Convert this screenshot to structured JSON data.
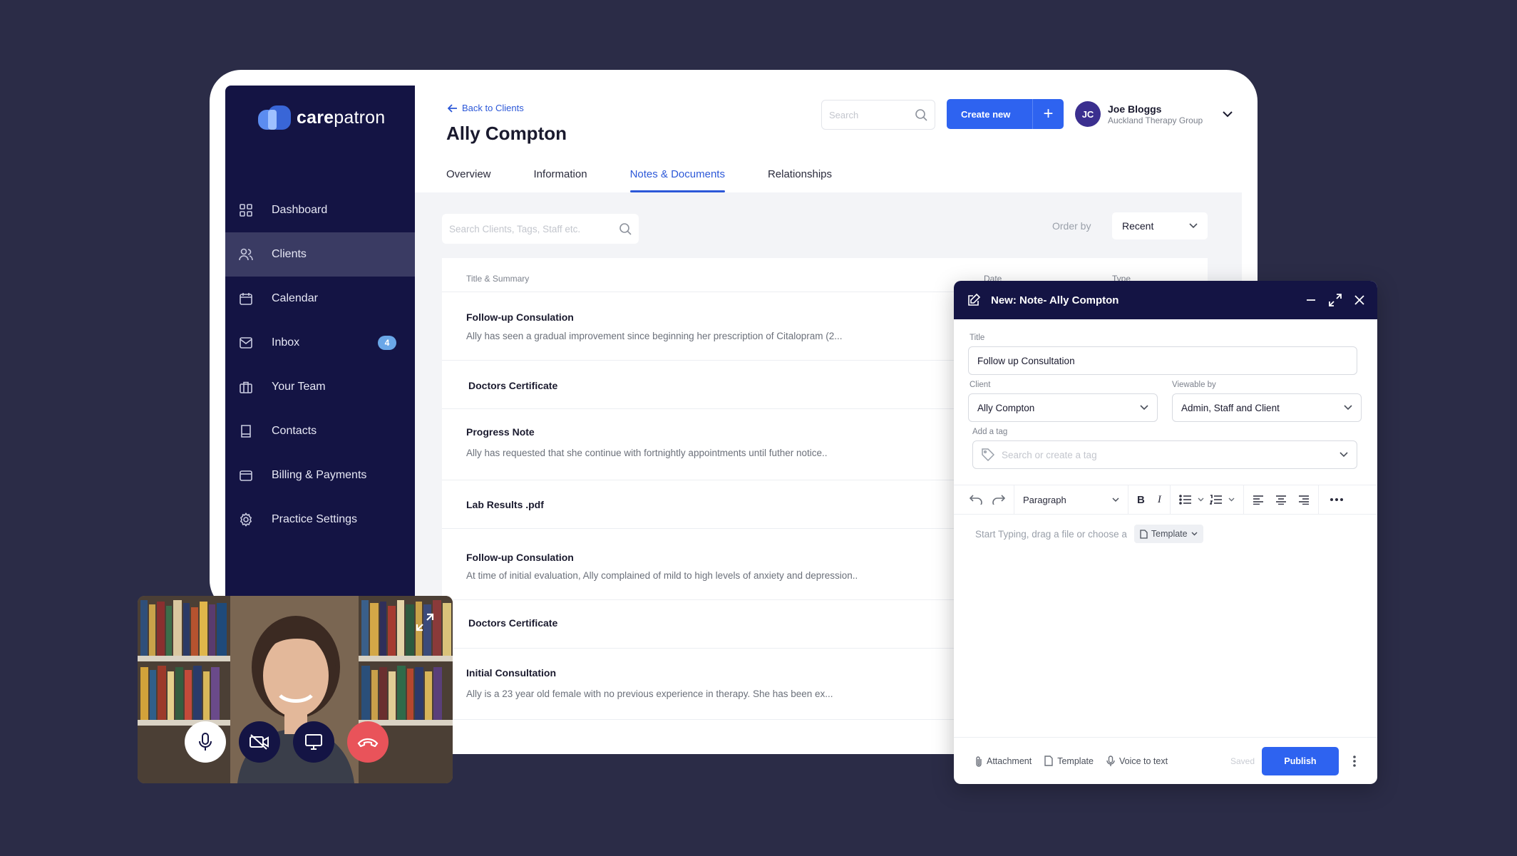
{
  "brand": {
    "name_bold": "care",
    "name_light": "patron"
  },
  "sidebar": {
    "items": [
      {
        "label": "Dashboard",
        "icon": "dashboard-icon"
      },
      {
        "label": "Clients",
        "icon": "users-icon",
        "active": true
      },
      {
        "label": "Calendar",
        "icon": "calendar-icon"
      },
      {
        "label": "Inbox",
        "icon": "mail-icon",
        "badge": "4"
      },
      {
        "label": "Your Team",
        "icon": "briefcase-icon"
      },
      {
        "label": "Contacts",
        "icon": "book-icon"
      },
      {
        "label": "Billing & Payments",
        "icon": "card-icon"
      },
      {
        "label": "Practice Settings",
        "icon": "gear-icon"
      }
    ]
  },
  "header": {
    "back_label": "Back to Clients",
    "title": "Ally Compton",
    "search_placeholder": "Search",
    "create_label": "Create new",
    "create_plus": "+",
    "user": {
      "initials": "JC",
      "name": "Joe Bloggs",
      "org": "Auckland Therapy Group"
    },
    "tabs": [
      "Overview",
      "Information",
      "Notes & Documents",
      "Relationships"
    ],
    "active_tab": "Notes & Documents"
  },
  "list": {
    "search_placeholder": "Search Clients, Tags, Staff etc.",
    "order_label": "Order by",
    "order_value": "Recent",
    "columns": [
      "Title & Summary",
      "Date",
      "Type"
    ],
    "rows": [
      {
        "title": "Follow-up Consulation",
        "summary": "Ally has seen a gradual improvement since beginning her prescription of Citalopram (2..."
      },
      {
        "title": "Doctors Certificate",
        "summary": ""
      },
      {
        "title": "Progress Note",
        "summary": "Ally has requested that she continue with fortnightly appointments until futher notice.."
      },
      {
        "title": "Lab Results .pdf",
        "summary": ""
      },
      {
        "title": "Follow-up Consulation",
        "summary": "At time of initial evaluation, Ally complained of mild to high levels of anxiety and depression.."
      },
      {
        "title": "Doctors Certificate",
        "summary": ""
      },
      {
        "title": "Initial Consultation",
        "summary": "Ally is a 23 year old female with no previous experience in therapy. She has been ex..."
      }
    ]
  },
  "note": {
    "header_title": "New: Note-  Ally Compton",
    "title_label": "Title",
    "title_value": "Follow up Consultation",
    "client_label": "Client",
    "client_value": "Ally Compton",
    "viewable_label": "Viewable by",
    "viewable_value": "Admin, Staff and Client",
    "tag_label": "Add a tag",
    "tag_placeholder": "Search or create a tag",
    "paragraph_label": "Paragraph",
    "bold": "B",
    "italic": "I",
    "editor_placeholder": "Start Typing, drag a file or choose a",
    "template_chip": "Template",
    "footer": {
      "attachment": "Attachment",
      "template": "Template",
      "voice": "Voice to text",
      "saved": "Saved",
      "publish": "Publish"
    }
  },
  "colors": {
    "sidebar_bg": "#141444",
    "accent": "#2e63f0",
    "link": "#2c58d8",
    "end_call": "#e9535a",
    "page_bg": "#2b2c47"
  }
}
